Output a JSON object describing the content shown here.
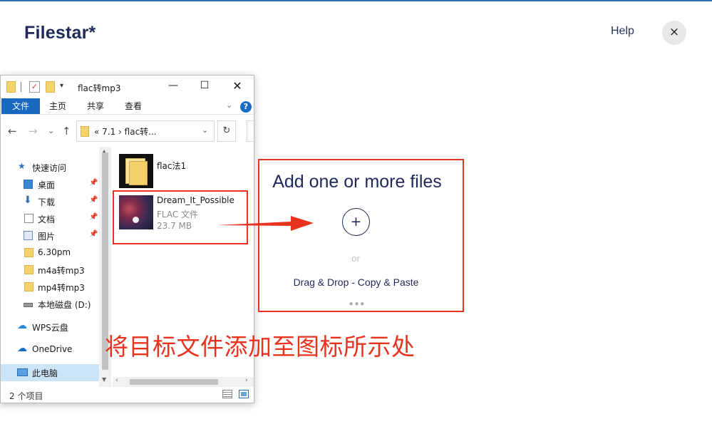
{
  "app": {
    "logo": "Filestar*",
    "help_label": "Help",
    "close_icon": "×"
  },
  "explorer": {
    "title": "flac转mp3",
    "controls": {
      "minimize": "—",
      "maximize": "☐",
      "close": "✕"
    },
    "ribbon": {
      "file_tab": "文件",
      "tabs": [
        "主页",
        "共享",
        "查看"
      ],
      "help": "?"
    },
    "nav": {
      "back": "←",
      "forward": "→",
      "recent": "⌄",
      "up": "↑",
      "refresh": "↻"
    },
    "address": {
      "text": "«  7.1  ›  flac转...",
      "dropdown": "⌄"
    },
    "sidebar": {
      "items": [
        {
          "label": "快速访问",
          "icon": "star-icon"
        },
        {
          "label": "桌面",
          "icon": "desktop-icon",
          "pinned": true
        },
        {
          "label": "下载",
          "icon": "download-icon",
          "pinned": true
        },
        {
          "label": "文档",
          "icon": "document-icon",
          "pinned": true
        },
        {
          "label": "图片",
          "icon": "picture-icon",
          "pinned": true
        },
        {
          "label": "6.30pm",
          "icon": "folder-icon"
        },
        {
          "label": "m4a转mp3",
          "icon": "folder-icon"
        },
        {
          "label": "mp4转mp3",
          "icon": "folder-icon"
        },
        {
          "label": "本地磁盘 (D:)",
          "icon": "drive-icon"
        },
        {
          "label": "WPS云盘",
          "icon": "cloud-icon"
        },
        {
          "label": "OneDrive",
          "icon": "onedrive-icon"
        },
        {
          "label": "此电脑",
          "icon": "computer-icon",
          "selected": true
        }
      ]
    },
    "files": [
      {
        "name": "flac法1",
        "type": "",
        "size": ""
      },
      {
        "name": "Dream_It_Possible",
        "type": "FLAC 文件",
        "size": "23.7 MB"
      }
    ],
    "status": {
      "count": "2 个项目"
    }
  },
  "drop_zone": {
    "title": "Add one or more files",
    "plus": "+",
    "or": "or",
    "drag_text": "Drag & Drop - Copy & Paste",
    "dots": "•••"
  },
  "annotation": {
    "instruction": "将目标文件添加至图标所示处",
    "color": "#e8331f"
  },
  "colors": {
    "brand": "#1f2a5a",
    "accent": "#1867c0",
    "annotation": "#e8331f"
  }
}
